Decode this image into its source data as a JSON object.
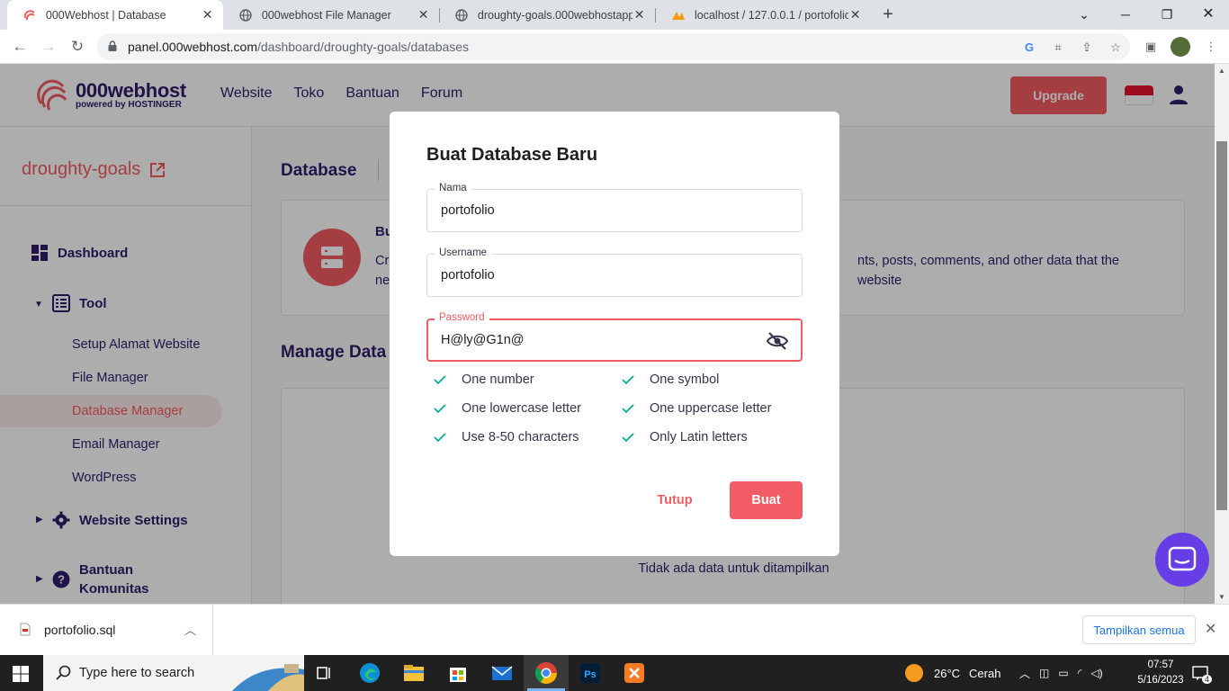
{
  "browser": {
    "tabs": [
      {
        "title": "000Webhost | Database",
        "active": true
      },
      {
        "title": "000webhost File Manager",
        "active": false
      },
      {
        "title": "droughty-goals.000webhostapp.c",
        "active": false
      },
      {
        "title": "localhost / 127.0.0.1 / portofolio |",
        "active": false
      }
    ],
    "url_host": "panel.000webhost.com",
    "url_path": "/dashboard/droughty-goals/databases"
  },
  "header": {
    "logo_main": "000webhost",
    "logo_sub": "powered by HOSTINGER",
    "nav": [
      "Website",
      "Toko",
      "Bantuan",
      "Forum"
    ],
    "upgrade_label": "Upgrade",
    "flag_colors": [
      "#e8112d",
      "#ffffff"
    ]
  },
  "sidebar": {
    "site_name": "droughty-goals",
    "items": [
      {
        "label": "Dashboard"
      },
      {
        "label": "Tool"
      },
      {
        "label": "Website Settings"
      },
      {
        "label": "Bantuan Komunitas",
        "line1": "Bantuan",
        "line2": "Komunitas"
      }
    ],
    "tool_subitems": [
      "Setup Alamat Website",
      "File Manager",
      "Database Manager",
      "Email Manager",
      "WordPress"
    ],
    "active_subitem": "Database Manager"
  },
  "main": {
    "page_title": "Database",
    "card_title": "Bu",
    "card_text_line1": "Cr",
    "card_text_line1_right": "nts, posts, comments, and other data that the website",
    "card_text_line2": "ne",
    "manage_title": "Manage Data",
    "empty_message": "Tidak ada data untuk ditampilkan"
  },
  "modal": {
    "title": "Buat Database Baru",
    "fields": {
      "name": {
        "label": "Nama",
        "value": "portofolio"
      },
      "username": {
        "label": "Username",
        "value": "portofolio"
      },
      "password": {
        "label": "Password",
        "value": "H@ly@G1n@",
        "state": "error"
      }
    },
    "requirements": [
      {
        "label": "One number",
        "met": true
      },
      {
        "label": "One symbol",
        "met": true
      },
      {
        "label": "One lowercase letter",
        "met": true
      },
      {
        "label": "One uppercase letter",
        "met": true
      },
      {
        "label": "Use 8-50 characters",
        "met": true
      },
      {
        "label": "Only Latin letters",
        "met": true
      }
    ],
    "cancel_label": "Tutup",
    "submit_label": "Buat"
  },
  "downloads": {
    "file": "portofolio.sql",
    "show_all_label": "Tampilkan semua"
  },
  "taskbar": {
    "search_placeholder": "Type here to search",
    "weather_temp": "26°C",
    "weather_text": "Cerah",
    "time": "07:57",
    "date": "5/16/2023",
    "notifications": "4"
  },
  "colors": {
    "accent": "#f25c64",
    "brand_text": "#2f1c6a",
    "chat": "#673de6",
    "check": "#00b090"
  }
}
